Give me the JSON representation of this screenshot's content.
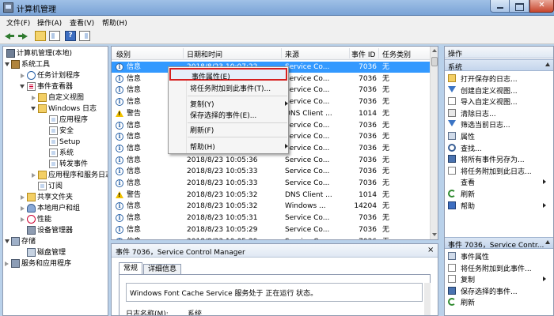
{
  "window": {
    "title": "计算机管理",
    "close_glyph": "✕"
  },
  "menu": {
    "items": [
      "文件(F)",
      "操作(A)",
      "查看(V)",
      "帮助(H)"
    ]
  },
  "toolbar": {
    "help_glyph": "?"
  },
  "tree": {
    "items": [
      {
        "label": "计算机管理(本地)",
        "icon": "computer-icon"
      },
      {
        "label": "系统工具",
        "icon": "tools-icon"
      },
      {
        "label": "任务计划程序",
        "icon": "clock-icon"
      },
      {
        "label": "事件查看器",
        "icon": "event-viewer-icon"
      },
      {
        "label": "自定义视图",
        "icon": "folder-icon"
      },
      {
        "label": "Windows 日志",
        "icon": "folder-icon"
      },
      {
        "label": "应用程序",
        "icon": "log-icon"
      },
      {
        "label": "安全",
        "icon": "log-icon"
      },
      {
        "label": "Setup",
        "icon": "log-icon"
      },
      {
        "label": "系统",
        "icon": "log-icon"
      },
      {
        "label": "转发事件",
        "icon": "log-icon"
      },
      {
        "label": "应用程序和服务日志",
        "icon": "folder-icon"
      },
      {
        "label": "订阅",
        "icon": "log-icon"
      },
      {
        "label": "共享文件夹",
        "icon": "shared-folder-icon"
      },
      {
        "label": "本地用户和组",
        "icon": "users-icon"
      },
      {
        "label": "性能",
        "icon": "performance-icon"
      },
      {
        "label": "设备管理器",
        "icon": "device-manager-icon"
      },
      {
        "label": "存储",
        "icon": "storage-icon"
      },
      {
        "label": "磁盘管理",
        "icon": "disk-icon"
      },
      {
        "label": "服务和应用程序",
        "icon": "services-icon"
      }
    ]
  },
  "events": {
    "columns": [
      "级别",
      "日期和时间",
      "来源",
      "事件 ID",
      "任务类别"
    ],
    "rows": [
      {
        "level": "信息",
        "kind": "info",
        "datetime": "2018/8/23 10:07:22",
        "source": "Service Co...",
        "id": "7036",
        "category": "无"
      },
      {
        "level": "信息",
        "kind": "info",
        "datetime": "2018/8/23 10:07:22",
        "source": "Service Co...",
        "id": "7036",
        "category": "无"
      },
      {
        "level": "信息",
        "kind": "info",
        "datetime": "2018/8/23 10:07:22",
        "source": "Service Co...",
        "id": "7036",
        "category": "无"
      },
      {
        "level": "信息",
        "kind": "info",
        "datetime": "2018/8/23 10:07:22",
        "source": "Service Co...",
        "id": "7036",
        "category": "无"
      },
      {
        "level": "警告",
        "kind": "warning",
        "datetime": "2018/8/23 10:07:22",
        "source": "DNS Client ...",
        "id": "1014",
        "category": "无"
      },
      {
        "level": "信息",
        "kind": "info",
        "datetime": "2018/8/23 10:07:22",
        "source": "Service Co...",
        "id": "7036",
        "category": "无"
      },
      {
        "level": "信息",
        "kind": "info",
        "datetime": "2018/8/23 10:07:22",
        "source": "Service Co...",
        "id": "7036",
        "category": "无"
      },
      {
        "level": "信息",
        "kind": "info",
        "datetime": "2018/8/23 10:05:40",
        "source": "Service Co...",
        "id": "7036",
        "category": "无"
      },
      {
        "level": "信息",
        "kind": "info",
        "datetime": "2018/8/23 10:05:36",
        "source": "Service Co...",
        "id": "7036",
        "category": "无"
      },
      {
        "level": "信息",
        "kind": "info",
        "datetime": "2018/8/23 10:05:33",
        "source": "Service Co...",
        "id": "7036",
        "category": "无"
      },
      {
        "level": "信息",
        "kind": "info",
        "datetime": "2018/8/23 10:05:33",
        "source": "Service Co...",
        "id": "7036",
        "category": "无"
      },
      {
        "level": "警告",
        "kind": "warning",
        "datetime": "2018/8/23 10:05:32",
        "source": "DNS Client ...",
        "id": "1014",
        "category": "无"
      },
      {
        "level": "信息",
        "kind": "info",
        "datetime": "2018/8/23 10:05:32",
        "source": "Windows ...",
        "id": "14204",
        "category": "无"
      },
      {
        "level": "信息",
        "kind": "info",
        "datetime": "2018/8/23 10:05:31",
        "source": "Service Co...",
        "id": "7036",
        "category": "无"
      },
      {
        "level": "信息",
        "kind": "info",
        "datetime": "2018/8/23 10:05:29",
        "source": "Service Co...",
        "id": "7036",
        "category": "无"
      },
      {
        "level": "信息",
        "kind": "info",
        "datetime": "2018/8/23 10:05:29",
        "source": "Service Co...",
        "id": "7036",
        "category": "无"
      },
      {
        "level": "信息",
        "kind": "info",
        "datetime": "2018/8/23 10:05:29",
        "source": "Service Co...",
        "id": "7036",
        "category": "无"
      }
    ]
  },
  "context_menu": {
    "items": [
      {
        "label": "事件属性(E)",
        "highlighted": true
      },
      {
        "label": "将任务附加到此事件(T)..."
      },
      {
        "label": "复制(Y)",
        "submenu": true
      },
      {
        "label": "保存选择的事件(E)..."
      },
      {
        "label": "刷新(F)"
      },
      {
        "label": "帮助(H)",
        "submenu": true
      }
    ]
  },
  "detail": {
    "title": "事件 7036，Service Control Manager",
    "close_glyph": "×",
    "tabs": [
      "常规",
      "详细信息"
    ],
    "description": "Windows Font Cache Service 服务处于 正在运行 状态。",
    "field_label": "日志名称(M):",
    "field_value": "系统"
  },
  "actions": {
    "header": "操作",
    "section1": "系统",
    "section1_items": [
      {
        "label": "打开保存的日志...",
        "icon": "open-log-icon"
      },
      {
        "label": "创建自定义视图...",
        "icon": "filter-icon"
      },
      {
        "label": "导入自定义视图...",
        "icon": "import-icon"
      },
      {
        "label": "清除日志...",
        "icon": "clear-log-icon"
      },
      {
        "label": "筛选当前日志...",
        "icon": "filter-icon"
      },
      {
        "label": "属性",
        "icon": "properties-icon"
      },
      {
        "label": "查找...",
        "icon": "find-icon"
      },
      {
        "label": "将所有事件另存为...",
        "icon": "save-icon"
      },
      {
        "label": "将任务附加到此日志...",
        "icon": "attach-task-icon"
      },
      {
        "label": "查看",
        "icon": "view-icon",
        "submenu": true
      },
      {
        "label": "刷新",
        "icon": "refresh-icon"
      },
      {
        "label": "帮助",
        "icon": "help-icon",
        "submenu": true
      }
    ],
    "section2": "事件 7036，Service Contr...",
    "section2_items": [
      {
        "label": "事件属性",
        "icon": "event-properties-icon"
      },
      {
        "label": "将任务附加到此事件...",
        "icon": "attach-task-icon"
      },
      {
        "label": "复制",
        "icon": "copy-icon",
        "submenu": true
      },
      {
        "label": "保存选择的事件...",
        "icon": "save-icon"
      },
      {
        "label": "刷新",
        "icon": "refresh-icon"
      }
    ]
  }
}
